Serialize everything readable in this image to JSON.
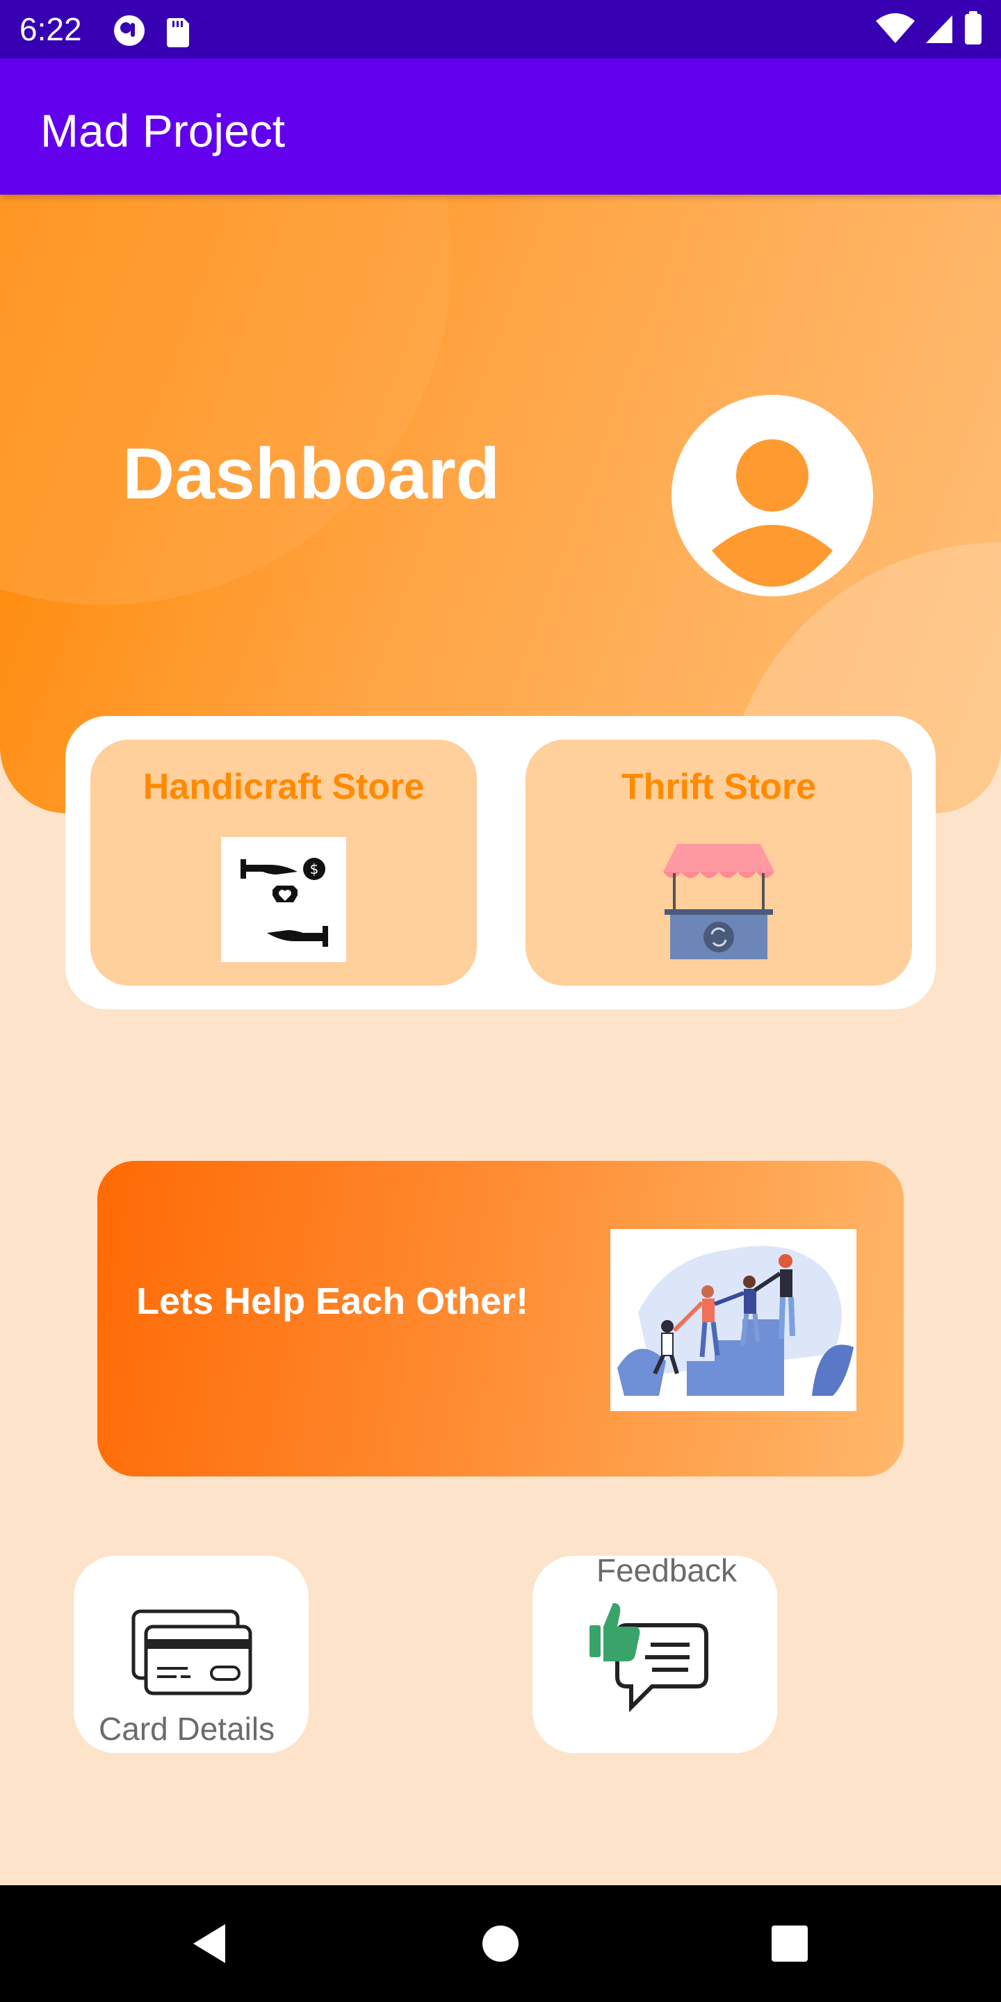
{
  "status_bar": {
    "time": "6:22",
    "left_icons": [
      "notification-app-icon",
      "sd-card-icon"
    ],
    "right_icons": [
      "wifi-icon",
      "cellular-signal-icon",
      "battery-icon"
    ]
  },
  "app_bar": {
    "title": "Mad Project"
  },
  "hero": {
    "title": "Dashboard",
    "avatar_icon": "profile-icon"
  },
  "stores": [
    {
      "label": "Handicraft Store",
      "icon": "donation-hands-icon"
    },
    {
      "label": "Thrift Store",
      "icon": "market-stall-icon"
    }
  ],
  "help_banner": {
    "text": "Lets Help Each Other!",
    "image": "people-helping-climb-illustration"
  },
  "tiles": {
    "card_details": {
      "label": "Card Details",
      "icon": "credit-card-icon"
    },
    "feedback": {
      "label": "Feedback",
      "icon": "feedback-thumbs-up-icon"
    }
  },
  "nav_bar": {
    "buttons": [
      "back-icon",
      "home-icon",
      "recent-apps-icon"
    ]
  },
  "colors": {
    "status_bar": "#3700b3",
    "app_bar": "#6200ee",
    "accent_orange": "#ff8a00",
    "background": "#fde3c9",
    "store_card": "#ffcf9c"
  }
}
